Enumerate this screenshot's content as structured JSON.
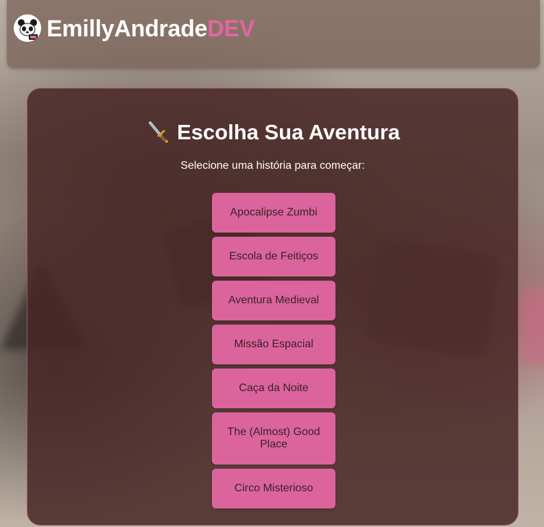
{
  "header": {
    "brand_main": "EmillyAndrade",
    "brand_accent": "DEV",
    "logo_icon": "panda-icon"
  },
  "panel": {
    "title": "Escolha Sua Aventura",
    "title_icon": "sword-icon",
    "subtitle": "Selecione uma história para começar:",
    "options": [
      {
        "label": "Apocalipse Zumbi"
      },
      {
        "label": "Escola de Feitiços"
      },
      {
        "label": "Aventura Medieval"
      },
      {
        "label": "Missão Espacial"
      },
      {
        "label": "Caça da Noite"
      },
      {
        "label": "The (Almost) Good Place"
      },
      {
        "label": "Circo Misterioso"
      }
    ]
  },
  "colors": {
    "accent": "#e0679f",
    "button": "#db649c",
    "panel": "#482826"
  }
}
